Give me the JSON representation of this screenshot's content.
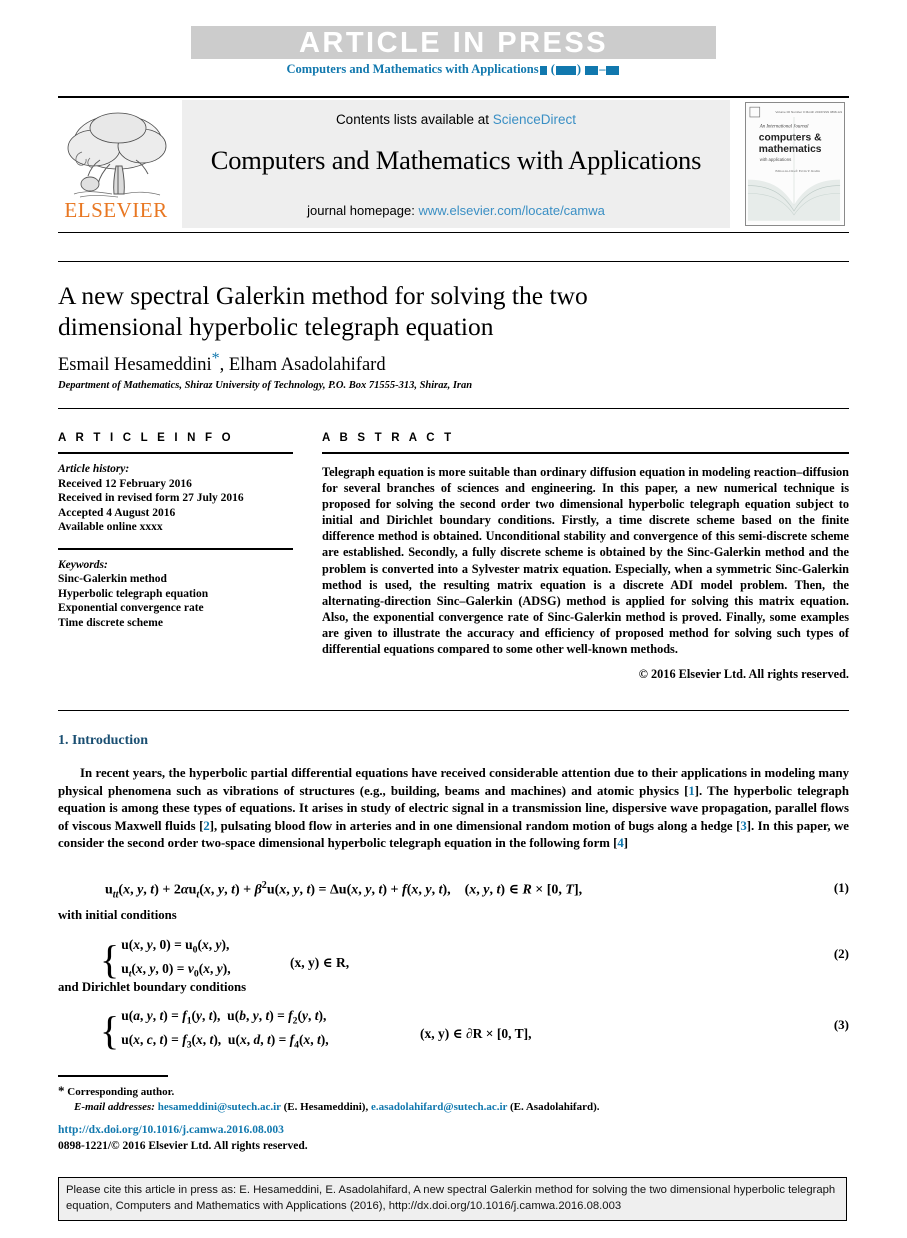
{
  "banner": {
    "headline": "ARTICLE  IN  PRESS",
    "journal_ref_prefix": "Computers and Mathematics with Applications",
    "journal_ref_redacted": "█ (████) ██–██"
  },
  "masthead": {
    "contents_prefix": "Contents lists available at ",
    "contents_link": "ScienceDirect",
    "journal_title": "Computers and Mathematics with Applications",
    "homepage_prefix": "journal homepage: ",
    "homepage_link": "www.elsevier.com/locate/camwa",
    "publisher_wordmark": "ELSEVIER",
    "publisher_logo_icon": "elsevier-tree-logo",
    "cover_icon": "journal-cover-thumbnail",
    "cover_lines": {
      "line1": "An International Journal",
      "line2": "computers &",
      "line3": "mathematics",
      "line4": "with applications",
      "line5": "Editor-in-Chief: Ervin Y. Rodin"
    }
  },
  "article": {
    "title": "A new spectral Galerkin method for solving the two dimensional hyperbolic telegraph equation",
    "authors_first": "Esmail Hesameddini",
    "authors_star": "*",
    "authors_rest": ", Elham Asadolahifard",
    "affiliation": "Department of Mathematics, Shiraz University of Technology, P.O. Box 71555-313, Shiraz, Iran"
  },
  "info": {
    "heading": "A R T I C L E   I N F O",
    "history_label": "Article history:",
    "history": [
      "Received 12 February 2016",
      "Received in revised form 27 July 2016",
      "Accepted 4 August 2016",
      "Available online xxxx"
    ],
    "keywords_label": "Keywords:",
    "keywords": [
      "Sinc-Galerkin method",
      "Hyperbolic telegraph equation",
      "Exponential convergence rate",
      "Time discrete scheme"
    ]
  },
  "abstract": {
    "heading": "A B S T R A C T",
    "text": "Telegraph equation is more suitable than ordinary diffusion equation in modeling reaction–diffusion for several branches of sciences and engineering. In this paper, a new numerical technique is proposed for solving the second order two dimensional hyperbolic telegraph equation subject to initial and Dirichlet boundary conditions. Firstly, a time discrete scheme based on the finite difference method is obtained. Unconditional stability and convergence of this semi-discrete scheme are established. Secondly, a fully discrete scheme is obtained by the Sinc-Galerkin method and the problem is converted into a Sylvester matrix equation. Especially, when a symmetric Sinc-Galerkin method is used, the resulting matrix equation is a discrete ADI model problem. Then, the alternating-direction Sinc–Galerkin (ADSG) method is applied for solving this matrix equation. Also, the exponential convergence rate of Sinc-Galerkin method is proved. Finally, some examples are given to illustrate the accuracy and efficiency of proposed method for solving such types of differential equations compared to some other well-known methods.",
    "copyright": "© 2016 Elsevier Ltd. All rights reserved."
  },
  "body": {
    "section_heading": "1. Introduction",
    "paragraph_1a": "In recent years, the hyperbolic partial differential equations have received considerable attention due to their applications in modeling many physical phenomena such as vibrations of structures (e.g., building, beams and machines) and atomic physics [",
    "ref1": "1",
    "paragraph_1b": "]. The hyperbolic telegraph equation is among these types of equations. It arises in study of electric signal in a transmission line, dispersive wave propagation, parallel flows of viscous Maxwell fluids [",
    "ref2": "2",
    "paragraph_1c": "], pulsating blood flow in arteries and in one dimensional random motion of bugs along a hedge [",
    "ref3": "3",
    "paragraph_1d": "]. In this paper, we consider the second order two-space dimensional hyperbolic telegraph equation in the following form [",
    "ref4": "4",
    "paragraph_1e": "]",
    "lead_initial": "with initial conditions",
    "lead_dirichlet": "and Dirichlet boundary conditions"
  },
  "equations": {
    "eq1_number": "(1)",
    "eq2_number": "(2)",
    "eq3_number": "(3)",
    "eq2_domain": "(x, y) ∈ R,",
    "eq3_domain": "(x, y) ∈ ∂R × [0, T],"
  },
  "footer": {
    "corresponding_marker": "*",
    "corresponding_label": "Corresponding author.",
    "email_label": "E-mail addresses:",
    "email_1": "hesameddini@sutech.ac.ir",
    "email_1_owner": "(E. Hesameddini),",
    "email_2": "e.asadolahifard@sutech.ac.ir",
    "email_2_owner": "(E. Asadolahifard).",
    "doi": "http://dx.doi.org/10.1016/j.camwa.2016.08.003",
    "issn": "0898-1221/© 2016 Elsevier Ltd. All rights reserved."
  },
  "citation": {
    "text": "Please cite this article in press as: E. Hesameddini, E. Asadolahifard, A new spectral Galerkin method for solving the two dimensional hyperbolic telegraph equation, Computers and Mathematics with Applications (2016), http://dx.doi.org/10.1016/j.camwa.2016.08.003"
  },
  "colors": {
    "link_blue": "#1178ae",
    "elsevier_orange": "#E87722",
    "banner_gray": "#cccccc",
    "band_gray": "#eeeeee",
    "cite_gray": "#efefef"
  }
}
